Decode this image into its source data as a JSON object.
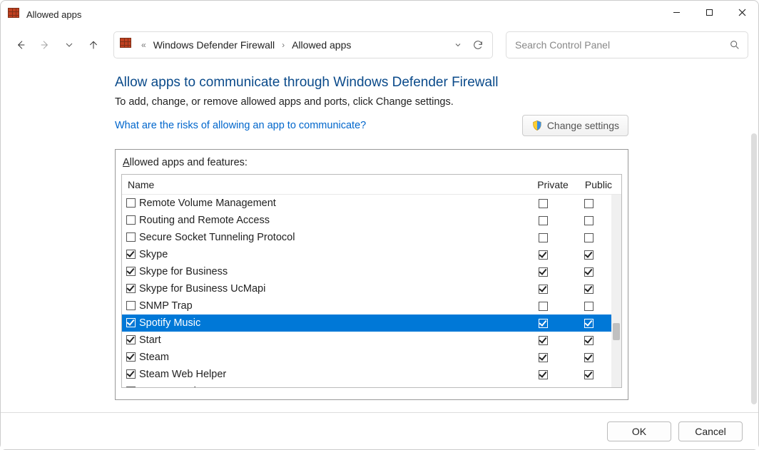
{
  "window": {
    "title": "Allowed apps"
  },
  "breadcrumbs": {
    "parent": "Windows Defender Firewall",
    "current": "Allowed apps"
  },
  "search": {
    "placeholder": "Search Control Panel"
  },
  "page": {
    "heading": "Allow apps to communicate through Windows Defender Firewall",
    "subtext": "To add, change, or remove allowed apps and ports, click Change settings.",
    "risklink": "What are the risks of allowing an app to communicate?",
    "change_btn": "Change settings",
    "list_label_pre": "A",
    "list_label_rest": "llowed apps and features:"
  },
  "columns": {
    "name": "Name",
    "private": "Private",
    "public": "Public"
  },
  "rows": [
    {
      "name": "Remote Volume Management",
      "enabled": false,
      "private": false,
      "public": false,
      "selected": false
    },
    {
      "name": "Routing and Remote Access",
      "enabled": false,
      "private": false,
      "public": false,
      "selected": false
    },
    {
      "name": "Secure Socket Tunneling Protocol",
      "enabled": false,
      "private": false,
      "public": false,
      "selected": false
    },
    {
      "name": "Skype",
      "enabled": true,
      "private": true,
      "public": true,
      "selected": false
    },
    {
      "name": "Skype for Business",
      "enabled": true,
      "private": true,
      "public": true,
      "selected": false
    },
    {
      "name": "Skype for Business UcMapi",
      "enabled": true,
      "private": true,
      "public": true,
      "selected": false
    },
    {
      "name": "SNMP Trap",
      "enabled": false,
      "private": false,
      "public": false,
      "selected": false
    },
    {
      "name": "Spotify Music",
      "enabled": true,
      "private": true,
      "public": true,
      "selected": true
    },
    {
      "name": "Start",
      "enabled": true,
      "private": true,
      "public": true,
      "selected": false
    },
    {
      "name": "Steam",
      "enabled": true,
      "private": true,
      "public": true,
      "selected": false
    },
    {
      "name": "Steam Web Helper",
      "enabled": true,
      "private": true,
      "public": true,
      "selected": false
    },
    {
      "name": "Store Experience Host",
      "enabled": true,
      "private": true,
      "public": true,
      "selected": false
    }
  ],
  "footer": {
    "ok": "OK",
    "cancel": "Cancel"
  }
}
